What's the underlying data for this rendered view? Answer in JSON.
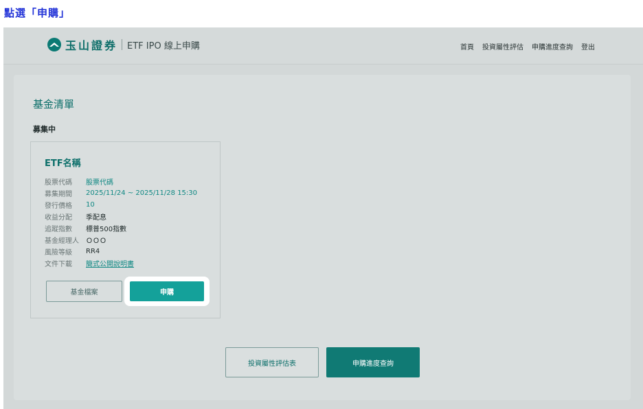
{
  "instruction": "點選「申購」",
  "header": {
    "logo_text": "玉山證券",
    "subtitle": "ETF IPO 線上申購",
    "nav": [
      "首頁",
      "投資屬性評估",
      "申購進度查詢",
      "登出"
    ]
  },
  "page": {
    "title": "基金清單",
    "section": "募集中"
  },
  "card": {
    "title": "ETF名稱",
    "rows": [
      {
        "label": "股票代碼",
        "value": "股票代碼"
      },
      {
        "label": "募集期間",
        "value": "2025/11/24 ~ 2025/11/28 15:30"
      },
      {
        "label": "發行價格",
        "value": "10"
      },
      {
        "label": "收益分配",
        "value": "季配息"
      },
      {
        "label": "追蹤指數",
        "value": "標普500指數"
      },
      {
        "label": "基金經理人",
        "value": "ＯＯＯ"
      },
      {
        "label": "風險等級",
        "value": "RR4"
      },
      {
        "label": "文件下載",
        "value": "簡式公開說明書"
      }
    ],
    "profile_button": "基金檔案",
    "apply_button": "申購"
  },
  "bottom": {
    "assessment_button": "投資屬性評估表",
    "progress_button": "申購進度查詢"
  },
  "colors": {
    "brand": "#0c6f6a",
    "accent": "#14a19a",
    "instruction": "#2435d8"
  },
  "icons": {
    "logo": "esun-mountain-logo-icon"
  }
}
